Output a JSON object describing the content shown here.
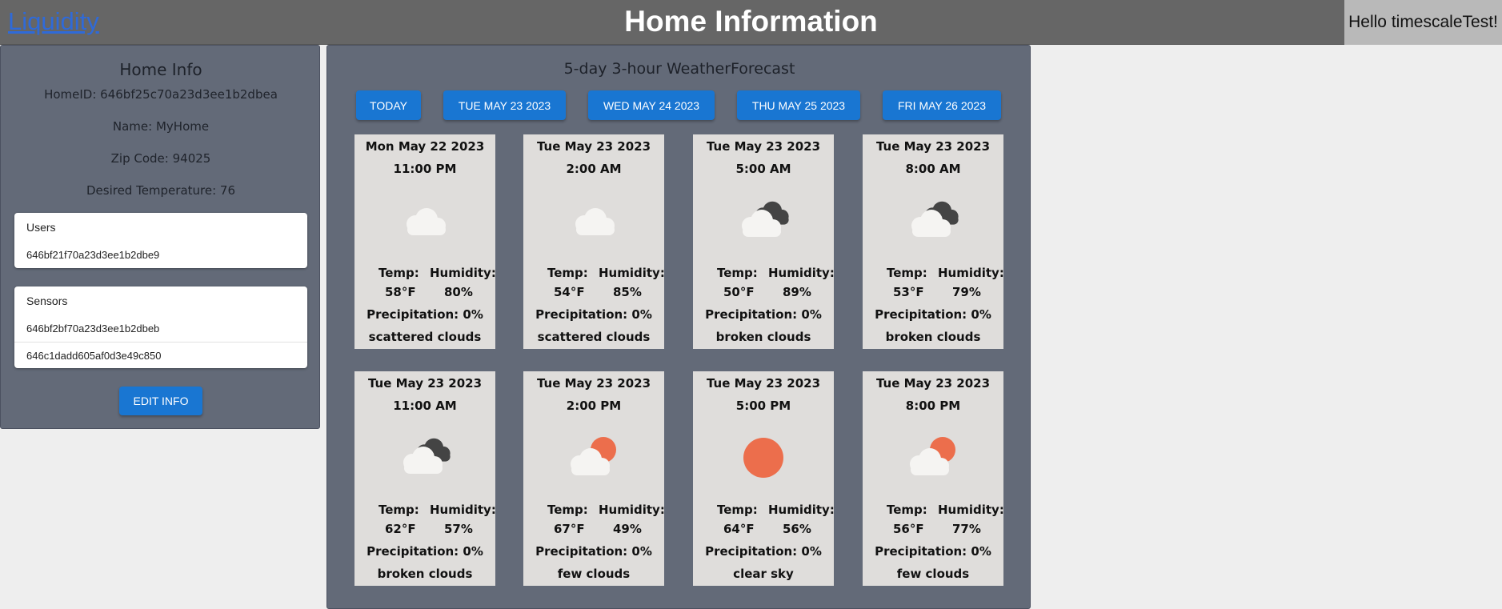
{
  "header": {
    "brand": "Liquidity",
    "title": "Home Information",
    "greeting": "Hello timescaleTest!"
  },
  "home": {
    "title": "Home Info",
    "home_id": "HomeID: 646bf25c70a23d3ee1b2dbea",
    "name": "Name: MyHome",
    "zip": "Zip Code: 94025",
    "desired_temp": "Desired Temperature: 76",
    "users": {
      "label": "Users",
      "items": [
        "646bf21f70a23d3ee1b2dbe9"
      ]
    },
    "sensors": {
      "label": "Sensors",
      "items": [
        "646bf2bf70a23d3ee1b2dbeb",
        "646c1dadd605af0d3e49c850"
      ]
    },
    "edit_label": "EDIT INFO"
  },
  "forecast": {
    "title": "5-day 3-hour WeatherForecast",
    "day_buttons": [
      "TODAY",
      "TUE MAY 23 2023",
      "WED MAY 24 2023",
      "THU MAY 25 2023",
      "FRI MAY 26 2023"
    ],
    "temp_label": "Temp:",
    "humidity_label": "Humidity:",
    "cards": [
      {
        "date": "Mon May 22 2023",
        "time": "11:00 PM",
        "icon": "scattered-clouds-icon",
        "temp": "58°F",
        "humidity": "80%",
        "precip": "Precipitation: 0%",
        "desc": "scattered clouds"
      },
      {
        "date": "Tue May 23 2023",
        "time": "2:00 AM",
        "icon": "scattered-clouds-icon",
        "temp": "54°F",
        "humidity": "85%",
        "precip": "Precipitation: 0%",
        "desc": "scattered clouds"
      },
      {
        "date": "Tue May 23 2023",
        "time": "5:00 AM",
        "icon": "broken-clouds-icon",
        "temp": "50°F",
        "humidity": "89%",
        "precip": "Precipitation: 0%",
        "desc": "broken clouds"
      },
      {
        "date": "Tue May 23 2023",
        "time": "8:00 AM",
        "icon": "broken-clouds-icon",
        "temp": "53°F",
        "humidity": "79%",
        "precip": "Precipitation: 0%",
        "desc": "broken clouds"
      },
      {
        "date": "Tue May 23 2023",
        "time": "11:00 AM",
        "icon": "broken-clouds-icon",
        "temp": "62°F",
        "humidity": "57%",
        "precip": "Precipitation: 0%",
        "desc": "broken clouds"
      },
      {
        "date": "Tue May 23 2023",
        "time": "2:00 PM",
        "icon": "few-clouds-icon",
        "temp": "67°F",
        "humidity": "49%",
        "precip": "Precipitation: 0%",
        "desc": "few clouds"
      },
      {
        "date": "Tue May 23 2023",
        "time": "5:00 PM",
        "icon": "clear-sky-icon",
        "temp": "64°F",
        "humidity": "56%",
        "precip": "Precipitation: 0%",
        "desc": "clear sky"
      },
      {
        "date": "Tue May 23 2023",
        "time": "8:00 PM",
        "icon": "few-clouds-icon",
        "temp": "56°F",
        "humidity": "77%",
        "precip": "Precipitation: 0%",
        "desc": "few clouds"
      }
    ]
  },
  "colors": {
    "header_bg": "#666666",
    "panel_bg": "#636a78",
    "button_blue": "#1976d2",
    "sun": "#ec6e4c",
    "cloud_dark": "#444444",
    "cloud_light": "#f5f4f2"
  }
}
